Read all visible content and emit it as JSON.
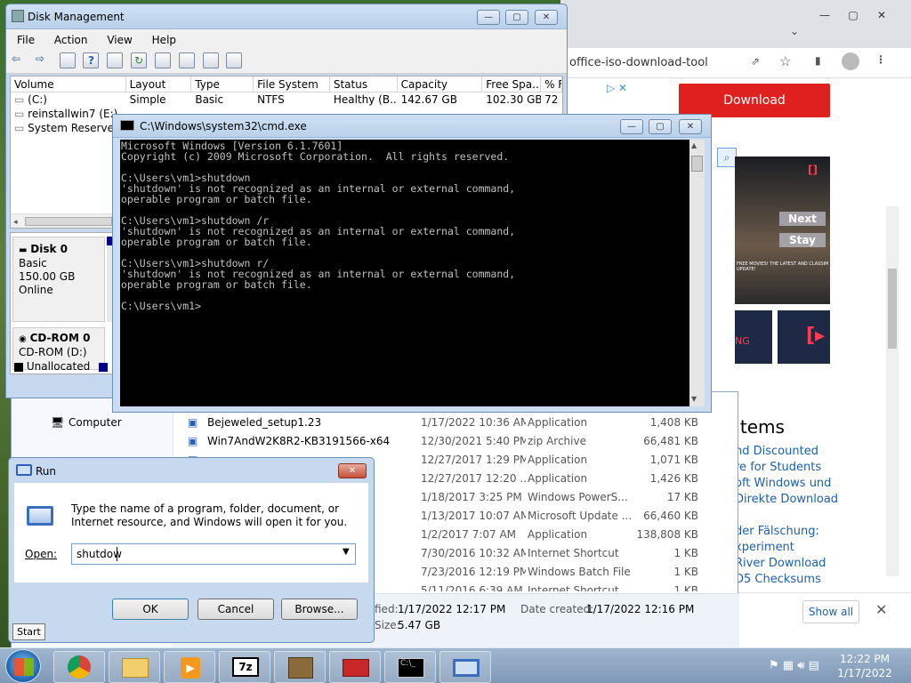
{
  "disk_mgmt": {
    "title": "Disk Management",
    "menu": [
      "File",
      "Action",
      "View",
      "Help"
    ],
    "columns": [
      "Volume",
      "Layout",
      "Type",
      "File System",
      "Status",
      "Capacity",
      "Free Spa...",
      "% F"
    ],
    "rows": [
      {
        "volume": "(C:)",
        "layout": "Simple",
        "type": "Basic",
        "fs": "NTFS",
        "status": "Healthy (B...",
        "capacity": "142.67 GB",
        "free": "102.30 GB",
        "pct": "72"
      },
      {
        "volume": "reinstallwin7 (E:)"
      },
      {
        "volume": "System Reserved"
      }
    ],
    "disk0": {
      "name": "Disk 0",
      "type": "Basic",
      "size": "150.00 GB",
      "state": "Online"
    },
    "cdrom0": {
      "name": "CD-ROM 0",
      "drive": "CD-ROM (D:)"
    },
    "legend_unallocated": "Unallocated",
    "legend_primary": "Pr"
  },
  "cmd": {
    "title": "C:\\Windows\\system32\\cmd.exe",
    "lines": [
      "Microsoft Windows [Version 6.1.7601]",
      "Copyright (c) 2009 Microsoft Corporation.  All rights reserved.",
      "",
      "C:\\Users\\vm1>shutdown",
      "'shutdown' is not recognized as an internal or external command,",
      "operable program or batch file.",
      "",
      "C:\\Users\\vm1>shutdown /r",
      "'shutdown' is not recognized as an internal or external command,",
      "operable program or batch file.",
      "",
      "C:\\Users\\vm1>shutdown r/",
      "'shutdown' is not recognized as an internal or external command,",
      "operable program or batch file.",
      "",
      "C:\\Users\\vm1>"
    ]
  },
  "explorer": {
    "nav_computer": "Computer",
    "files": [
      {
        "name": "Bejeweled_setup1.23",
        "date": "1/17/2022 10:36 AM",
        "type": "Application",
        "size": "1,408 KB"
      },
      {
        "name": "Win7AndW2K8R2-KB3191566-x64",
        "date": "12/30/2021 5:40 PM",
        "type": "zip Archive",
        "size": "66,481 KB"
      },
      {
        "name": "",
        "date": "12/27/2017 1:29 PM",
        "type": "Application",
        "size": "1,071 KB"
      },
      {
        "name": "",
        "date": "12/27/2017 12:20 ...",
        "type": "Application",
        "size": "1,426 KB"
      },
      {
        "name": "",
        "date": "1/18/2017 3:25 PM",
        "type": "Windows PowerS...",
        "size": "17 KB"
      },
      {
        "name": "",
        "date": "1/13/2017 10:07 AM",
        "type": "Microsoft Update ...",
        "size": "66,460 KB"
      },
      {
        "name": "0",
        "date": "1/2/2017 7:07 AM",
        "type": "Application",
        "size": "138,808 KB"
      },
      {
        "name": "",
        "date": "7/30/2016 10:32 AM",
        "type": "Internet Shortcut",
        "size": "1 KB"
      },
      {
        "name": "",
        "date": "7/23/2016 12:19 PM",
        "type": "Windows Batch File",
        "size": "1 KB"
      },
      {
        "name": "",
        "date": "5/11/2016 6:39 AM",
        "type": "Internet Shortcut",
        "size": "1 KB"
      }
    ],
    "details_modified_label": "fied:",
    "details_modified": "1/17/2022 12:17 PM",
    "details_created_label": "Date created:",
    "details_created": "1/17/2022 12:16 PM",
    "details_size_label": "Size:",
    "details_size": "5.47 GB"
  },
  "chrome": {
    "url": "office-iso-download-tool",
    "download_label": "Download",
    "ad_next": "Next",
    "ad_stay": "Stay",
    "ad_caption": "FREE MOVIES! THE LATEST AND CLASSIM UPDATE!",
    "ad_tile1": "NG",
    "items_heading": "Items",
    "links": [
      "nd Discounted",
      "re for Students",
      "oft Windows und",
      "Direkte Download",
      "der Fälschung:",
      "xperiment",
      "River Download",
      "D5 Checksums"
    ],
    "show_all": "Show all"
  },
  "run": {
    "title": "Run",
    "description": "Type the name of a program, folder, document, or Internet resource, and Windows will open it for you.",
    "open_label": "Open:",
    "open_value": "shutdow",
    "ok": "OK",
    "cancel": "Cancel",
    "browse": "Browse..."
  },
  "tooltip": "Start",
  "clock": {
    "time": "12:22 PM",
    "date": "1/17/2022"
  }
}
